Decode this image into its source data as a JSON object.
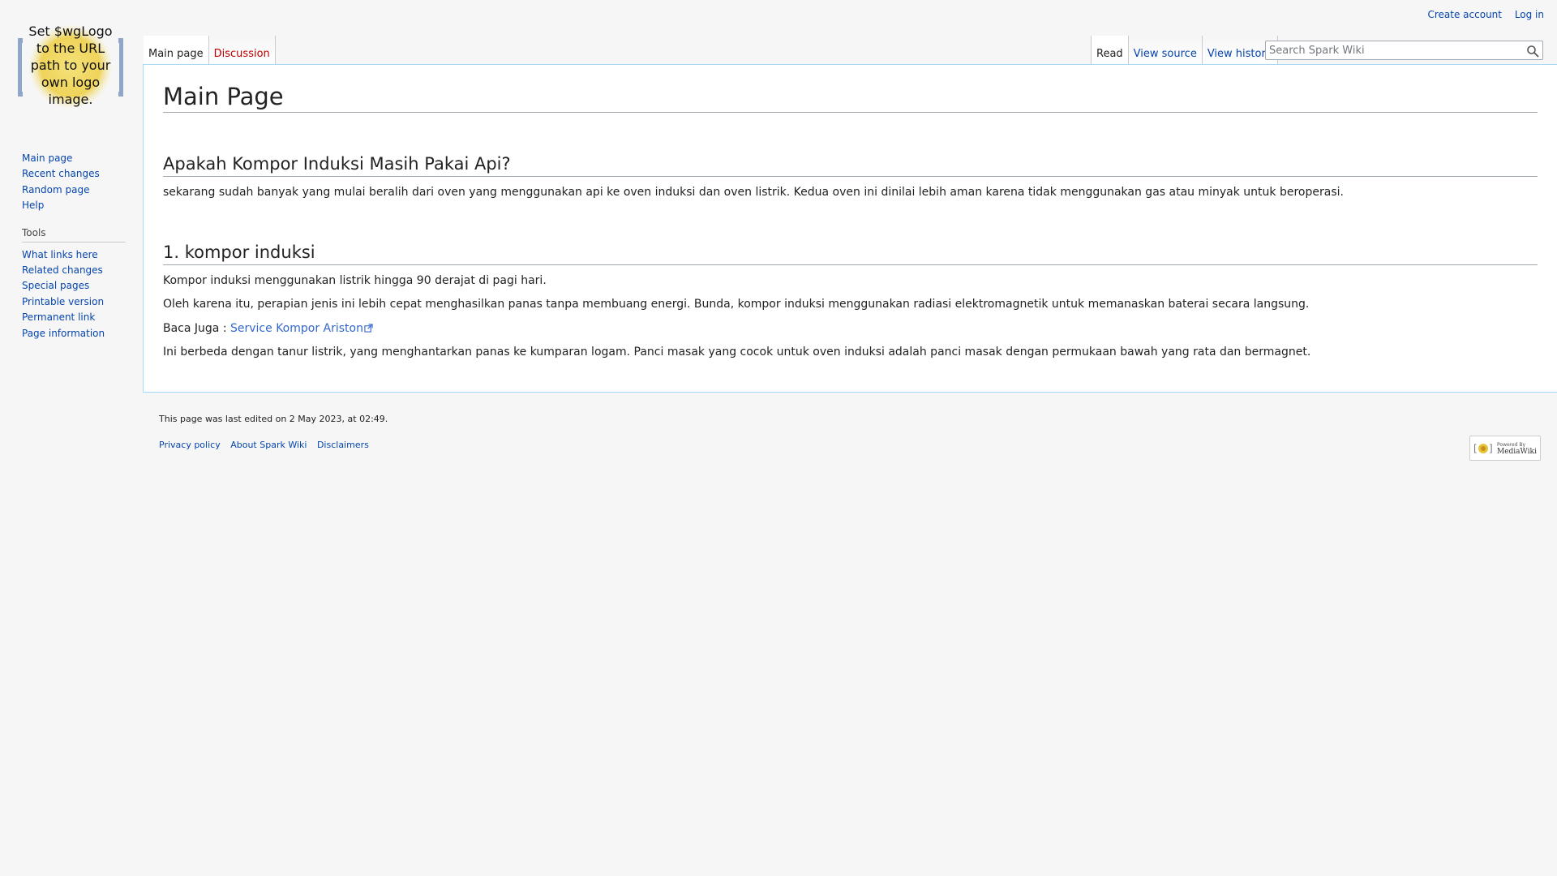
{
  "logo": {
    "lines": [
      "Set $wgLogo",
      "to the URL",
      "path to your",
      "own logo",
      "image."
    ]
  },
  "personal": {
    "create_account": "Create account",
    "log_in": "Log in"
  },
  "nav": {
    "items": [
      {
        "label": "Main page"
      },
      {
        "label": "Recent changes"
      },
      {
        "label": "Random page"
      },
      {
        "label": "Help"
      }
    ]
  },
  "tools": {
    "heading": "Tools",
    "items": [
      {
        "label": "What links here"
      },
      {
        "label": "Related changes"
      },
      {
        "label": "Special pages"
      },
      {
        "label": "Printable version"
      },
      {
        "label": "Permanent link"
      },
      {
        "label": "Page information"
      }
    ]
  },
  "tabs": {
    "main_page": "Main page",
    "discussion": "Discussion",
    "read": "Read",
    "view_source": "View source",
    "view_history": "View history"
  },
  "search": {
    "placeholder": "Search Spark Wiki"
  },
  "content": {
    "title": "Main Page",
    "section1": {
      "heading": "Apakah Kompor Induksi Masih Pakai Api?",
      "para": "sekarang sudah banyak yang mulai beralih dari oven yang menggunakan api ke oven induksi dan oven listrik. Kedua oven ini dinilai lebih aman karena tidak menggunakan gas atau minyak untuk beroperasi."
    },
    "section2": {
      "heading": "1. kompor induksi",
      "para1": "Kompor induksi menggunakan listrik hingga 90 derajat di pagi hari.",
      "para2": "Oleh karena itu, perapian jenis ini lebih cepat menghasilkan panas tanpa membuang energi. Bunda, kompor induksi menggunakan radiasi elektromagnetik untuk memanaskan baterai secara langsung.",
      "baca_prefix": "Baca Juga : ",
      "baca_link": "Service Kompor Ariston",
      "para3": "Ini berbeda dengan tanur listrik, yang menghantarkan panas ke kumparan logam. Panci masak yang cocok untuk oven induksi adalah panci masak dengan permukaan bawah yang rata dan bermagnet."
    }
  },
  "footer": {
    "last_edited": "This page was last edited on 2 May 2023, at 02:49.",
    "privacy": "Privacy policy",
    "about": "About Spark Wiki",
    "disclaimers": "Disclaimers",
    "powered_by_line1": "Powered By",
    "powered_by_line2": "MediaWiki"
  },
  "colors": {
    "link": "#0645ad",
    "new_link": "#ba0000",
    "external_link": "#3366cc",
    "content_border": "#a7d7f9"
  }
}
